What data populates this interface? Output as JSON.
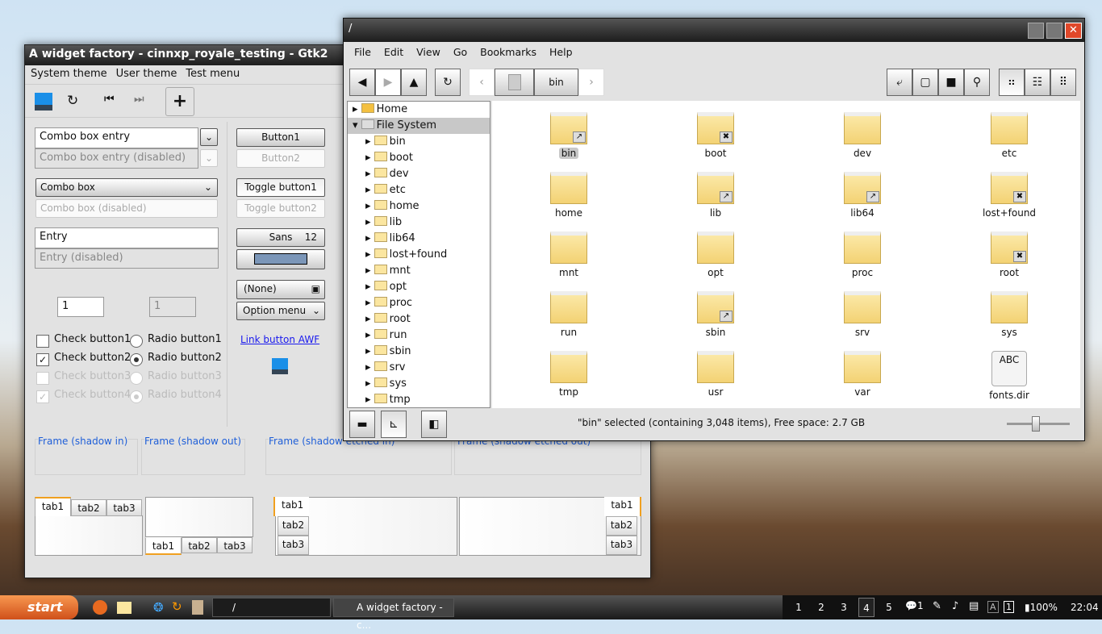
{
  "widget_factory": {
    "title": "A widget factory - cinnxp_royale_testing - Gtk2",
    "menu": [
      "System theme",
      "User theme",
      "Test menu"
    ],
    "combo_entry": "Combo box entry",
    "combo_entry_disabled": "Combo box entry (disabled)",
    "combo": "Combo box",
    "combo_disabled": "Combo box (disabled)",
    "entry": "Entry",
    "entry_disabled": "Entry (disabled)",
    "spin1": "1",
    "spin2": "1",
    "button1": "Button1",
    "button2": "Button2",
    "toggle1": "Toggle button1",
    "toggle2": "Toggle button2",
    "font_name": "Sans",
    "font_size": "12",
    "color_swatch": "#7b96b8",
    "file_chooser": "(None)",
    "option_menu": "Option menu",
    "link": "Link button AWF",
    "checks": [
      {
        "label": "Check button1",
        "checked": false
      },
      {
        "label": "Check button2",
        "checked": true
      },
      {
        "label": "Check button3",
        "checked": false
      },
      {
        "label": "Check button4",
        "checked": true
      }
    ],
    "radios": [
      {
        "label": "Radio button1",
        "selected": false
      },
      {
        "label": "Radio button2",
        "selected": true
      },
      {
        "label": "Radio button3",
        "selected": false
      },
      {
        "label": "Radio button4",
        "selected": true
      }
    ],
    "frames": [
      "Frame (shadow in)",
      "Frame (shadow out)",
      "Frame (shadow etched in)",
      "Frame (shadow etched out)"
    ],
    "tabs": [
      "tab1",
      "tab2",
      "tab3"
    ]
  },
  "file_manager": {
    "title": "/",
    "menu": [
      "File",
      "Edit",
      "View",
      "Go",
      "Bookmarks",
      "Help"
    ],
    "path_current": "bin",
    "sidebar": {
      "home": "Home",
      "filesystem": "File System",
      "items": [
        "bin",
        "boot",
        "dev",
        "etc",
        "home",
        "lib",
        "lib64",
        "lost+found",
        "mnt",
        "opt",
        "proc",
        "root",
        "run",
        "sbin",
        "srv",
        "sys",
        "tmp"
      ]
    },
    "files": [
      {
        "name": "bin",
        "emblem": "link",
        "selected": true
      },
      {
        "name": "boot",
        "emblem": "x"
      },
      {
        "name": "dev"
      },
      {
        "name": "etc"
      },
      {
        "name": "home"
      },
      {
        "name": "lib",
        "emblem": "link"
      },
      {
        "name": "lib64",
        "emblem": "link"
      },
      {
        "name": "lost+found",
        "emblem": "x"
      },
      {
        "name": "mnt"
      },
      {
        "name": "opt"
      },
      {
        "name": "proc"
      },
      {
        "name": "root",
        "emblem": "x"
      },
      {
        "name": "run"
      },
      {
        "name": "sbin",
        "emblem": "link"
      },
      {
        "name": "srv"
      },
      {
        "name": "sys"
      },
      {
        "name": "tmp"
      },
      {
        "name": "usr"
      },
      {
        "name": "var"
      },
      {
        "name": "fonts.dir",
        "type": "text",
        "icon_text": "ABC"
      }
    ],
    "status": "\"bin\" selected (containing 3,048 items), Free space: 2.7 GB",
    "zoom_level": 0.45
  },
  "taskbar": {
    "start": "start",
    "tasks": [
      "/",
      "A widget factory - c..."
    ],
    "workspaces": [
      "1",
      "2",
      "3",
      "4",
      "5"
    ],
    "active_workspace": "4",
    "notif_count": "1",
    "kbd_a": "A",
    "kbd_1": "1",
    "battery": "100%",
    "clock": "22:04"
  }
}
